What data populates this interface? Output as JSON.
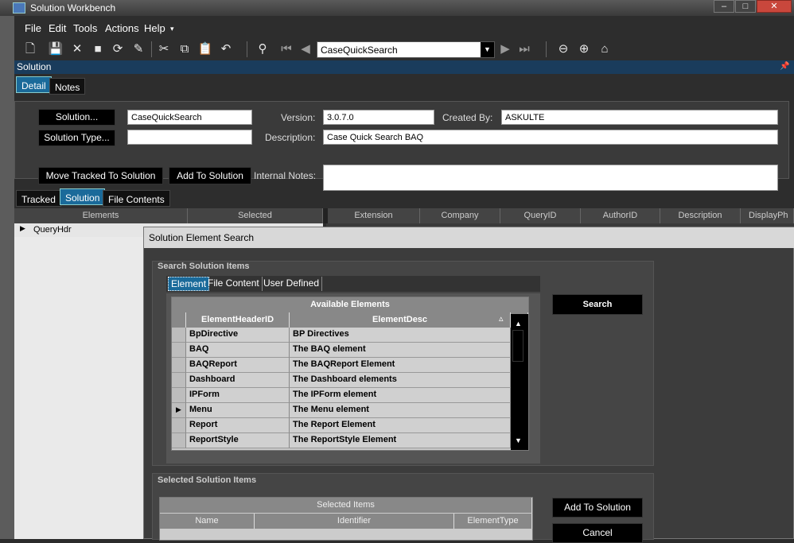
{
  "window": {
    "title": "Solution Workbench"
  },
  "menu": [
    "File",
    "Edit",
    "Tools",
    "Actions",
    "Help"
  ],
  "toolbar": {
    "nav_value": "CaseQuickSearch"
  },
  "panel": {
    "title": "Solution"
  },
  "tabs": {
    "detail": "Detail",
    "notes": "Notes"
  },
  "detail": {
    "solution_btn": "Solution...",
    "solution_value": "CaseQuickSearch",
    "solution_type_btn": "Solution Type...",
    "solution_type_value": "",
    "move_tracked_btn": "Move Tracked To Solution",
    "add_to_solution_btn": "Add To Solution",
    "version_label": "Version:",
    "version_value": "3.0.7.0",
    "created_by_label": "Created By:",
    "created_by_value": "ASKULTE",
    "description_label": "Description:",
    "description_value": "Case Quick Search BAQ",
    "internal_notes_label": "Internal Notes:",
    "internal_notes_value": ""
  },
  "lower_tabs": {
    "tracked": "Tracked",
    "solution": "Solution",
    "file_contents": "File Contents"
  },
  "grid": {
    "left_columns": [
      "Elements",
      "Selected"
    ],
    "right_columns": [
      "Extension",
      "Company",
      "QueryID",
      "AuthorID",
      "Description",
      "DisplayPh"
    ],
    "rows": [
      {
        "label": "QueryHdr"
      }
    ]
  },
  "dialog": {
    "title": "Solution Element Search",
    "search_group_title": "Search Solution Items",
    "subtabs": [
      "Element",
      "File Content",
      "User Defined"
    ],
    "available_caption": "Available Elements",
    "columns": [
      "ElementHeaderID",
      "ElementDesc"
    ],
    "rows": [
      {
        "id": "BpDirective",
        "desc": "BP Directives"
      },
      {
        "id": "BAQ",
        "desc": "The BAQ element"
      },
      {
        "id": "BAQReport",
        "desc": "The BAQReport Element"
      },
      {
        "id": "Dashboard",
        "desc": "The Dashboard elements"
      },
      {
        "id": "IPForm",
        "desc": "The IPForm element"
      },
      {
        "id": "Menu",
        "desc": "The Menu element",
        "current": true
      },
      {
        "id": "Report",
        "desc": "The Report Element"
      },
      {
        "id": "ReportStyle",
        "desc": "The ReportStyle Element"
      }
    ],
    "search_btn": "Search",
    "selected_group_title": "Selected Solution Items",
    "selected_caption": "Selected Items",
    "selected_columns": [
      "Name",
      "Identifier",
      "ElementType"
    ],
    "add_to_solution_btn": "Add To Solution",
    "cancel_btn": "Cancel"
  },
  "colors": {
    "accent": "#1a6a9a",
    "panel_header": "#1a3c5c"
  }
}
